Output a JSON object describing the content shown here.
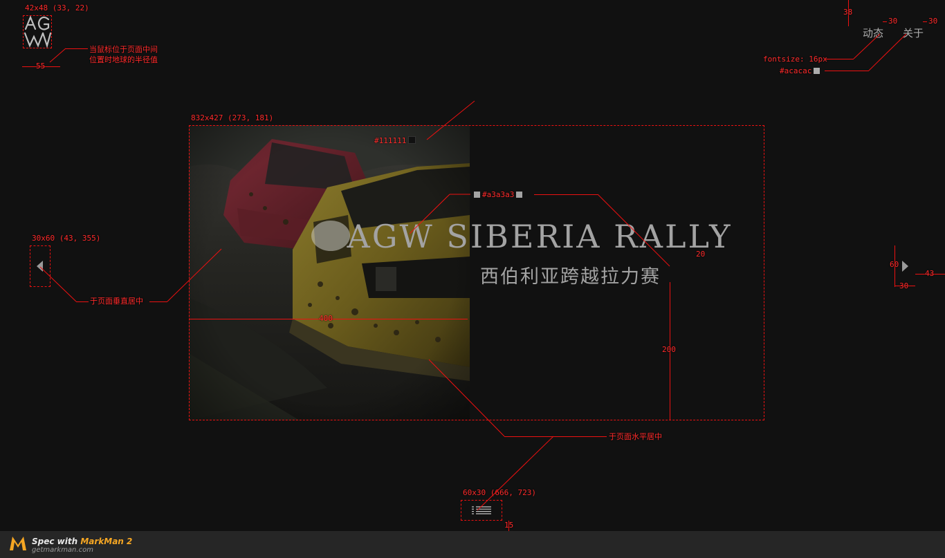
{
  "nav": {
    "items": [
      {
        "label": "动态"
      },
      {
        "label": "关于"
      }
    ]
  },
  "slide": {
    "title_en": "AGW SIBERIA RALLY",
    "title_cn": "西伯利亚跨越拉力赛"
  },
  "colors": {
    "background": "#111111",
    "title_text": "#a3a3a3",
    "nav_text": "#acacac",
    "annotation": "#ee1111",
    "footer_bg": "#262626",
    "footer_brand": "#f5a623"
  },
  "icons": {
    "logo": "agw-logo",
    "prev": "triangle-left-icon",
    "next": "triangle-right-icon",
    "menu": "list-menu-icon"
  },
  "annotations": {
    "logo_size": "42x48 (33, 22)",
    "logo_note_line1": "当鼠标位于页面中间",
    "logo_note_line2": "位置时地球的半径值",
    "logo_width": "55",
    "nav_top": "38",
    "nav_gap": "30",
    "nav_right": "30",
    "nav_fontsize": "fontsize: 16px",
    "nav_color": "#acacac",
    "slide_size": "832x427 (273, 181)",
    "bg_color": "#111111",
    "title_color": "#a3a3a3",
    "title_gap": "20",
    "title_bottom": "200",
    "photo_width": "400",
    "prev_size": "30x60 (43, 355)",
    "vertical_center": "于页面垂直居中",
    "next_height": "60",
    "next_right": "43",
    "next_width": "30",
    "horizontal_center": "于页面水平居中",
    "menu_size": "60x30 (666, 723)",
    "menu_bottom": "15"
  },
  "footer": {
    "spec_with": "Spec with ",
    "brand": "MarkMan 2",
    "site": "getmarkman.com"
  }
}
